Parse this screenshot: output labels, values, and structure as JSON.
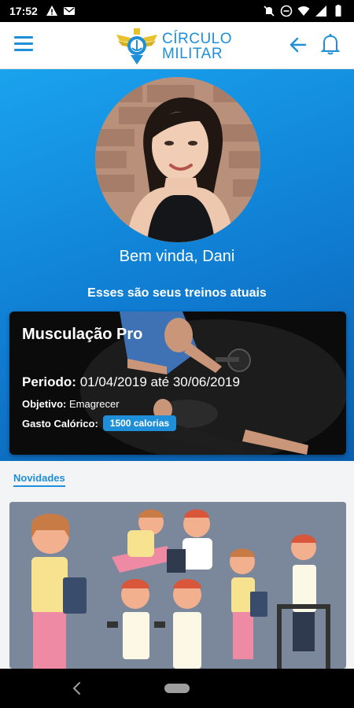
{
  "status_bar": {
    "time": "17:52"
  },
  "header": {
    "logo_line1": "CÍRCULO",
    "logo_line2": "MILITAR",
    "icons": [
      "menu-icon",
      "arrow-left-icon",
      "bell-icon"
    ]
  },
  "profile": {
    "greeting": "Bem vinda, Dani",
    "subtitle": "Esses são seus treinos atuais"
  },
  "workout": {
    "title": "Musculação Pro",
    "period_label": "Periodo:",
    "period_value": "01/04/2019 até 30/06/2019",
    "goal_label": "Objetivo:",
    "goal_value": "Emagrecer",
    "calories_label": "Gasto Calórico:",
    "calories_value": "1500 calorias"
  },
  "news": {
    "label": "Novidades"
  },
  "colors": {
    "accent": "#1e8fd8",
    "hero_top": "#1aa3ee",
    "hero_bottom": "#0b5fae"
  }
}
